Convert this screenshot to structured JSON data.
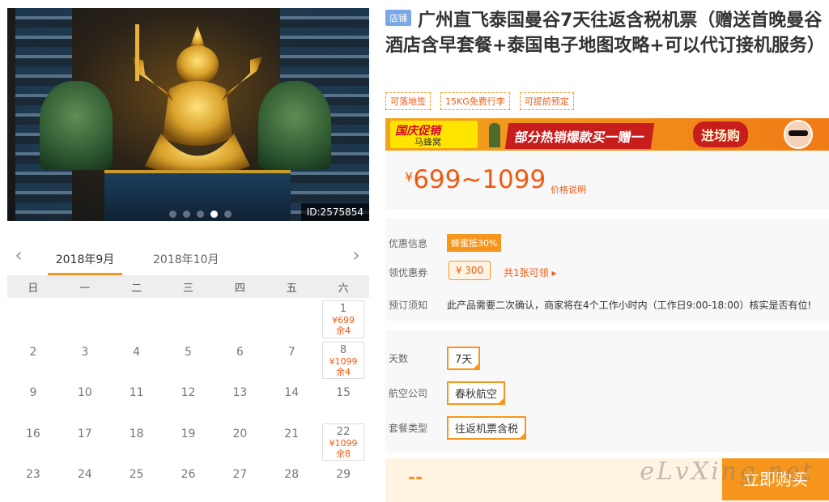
{
  "photo": {
    "id_label": "ID:2575854",
    "slides": 5,
    "active_slide": 4
  },
  "calendar": {
    "months": [
      "2018年9月",
      "2018年10月"
    ],
    "weekdays": [
      "日",
      "一",
      "二",
      "三",
      "四",
      "五",
      "六"
    ],
    "weeks": [
      [
        {
          "d": ""
        },
        {
          "d": ""
        },
        {
          "d": ""
        },
        {
          "d": ""
        },
        {
          "d": ""
        },
        {
          "d": ""
        },
        {
          "d": "1",
          "price": "¥699",
          "stock": "余4"
        }
      ],
      [
        {
          "d": "2"
        },
        {
          "d": "3"
        },
        {
          "d": "4"
        },
        {
          "d": "5"
        },
        {
          "d": "6"
        },
        {
          "d": "7"
        },
        {
          "d": "8",
          "price": "¥1099",
          "stock": "余4"
        }
      ],
      [
        {
          "d": "9"
        },
        {
          "d": "10"
        },
        {
          "d": "11"
        },
        {
          "d": "12"
        },
        {
          "d": "13"
        },
        {
          "d": "14"
        },
        {
          "d": "15"
        }
      ],
      [
        {
          "d": "16"
        },
        {
          "d": "17"
        },
        {
          "d": "18"
        },
        {
          "d": "19"
        },
        {
          "d": "20"
        },
        {
          "d": "21"
        },
        {
          "d": "22",
          "price": "¥1099",
          "stock": "余8"
        }
      ],
      [
        {
          "d": "23"
        },
        {
          "d": "24"
        },
        {
          "d": "25"
        },
        {
          "d": "26"
        },
        {
          "d": "27"
        },
        {
          "d": "28"
        },
        {
          "d": "29"
        }
      ]
    ]
  },
  "product": {
    "shop_tag": "店铺",
    "title": "广州直飞泰国曼谷7天往返含税机票（赠送首晚曼谷酒店含早套餐+泰国电子地图攻略+可以代订接机服务）",
    "tags": [
      "可落地签",
      "15KG免费行李",
      "可提前预定"
    ]
  },
  "banner": {
    "logo_main": "国庆促销",
    "logo_sub": "马蜂窝",
    "slogan": "部分热销爆款买一赠一",
    "cta": "进场购"
  },
  "price": {
    "currency": "¥",
    "range": "699~1099",
    "help": "价格说明"
  },
  "info": {
    "discount_label": "优惠信息",
    "discount_value": "蜂蜜抵30%",
    "coupon_label": "领优惠券",
    "coupon_value": "¥ 300",
    "coupon_link": "共1张可领 ▸",
    "notice_label": "预订须知",
    "notice_text": "此产品需要二次确认，商家将在4个工作小时内（工作日9:00-18:00）核实是否有位!"
  },
  "options": {
    "days_label": "天数",
    "days_value": "7天",
    "airline_label": "航空公司",
    "airline_value": "春秋航空",
    "package_label": "套餐类型",
    "package_value": "往返机票含税"
  },
  "buy": {
    "total": "--",
    "button": "立即购买"
  },
  "watermark": "eLvXing.net",
  "colors": {
    "accent": "#f7961c",
    "price": "#f05a14",
    "shop_tag": "#7aa7e7"
  }
}
